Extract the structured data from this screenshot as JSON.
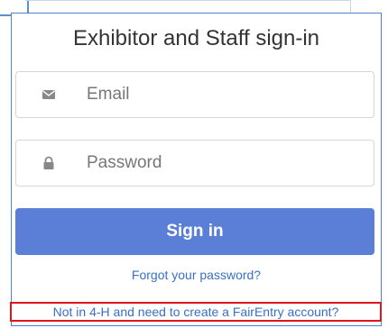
{
  "signin": {
    "title": "Exhibitor and Staff sign-in",
    "email": {
      "placeholder": "Email",
      "icon": "envelope-icon"
    },
    "password": {
      "placeholder": "Password",
      "icon": "lock-icon"
    },
    "submit_label": "Sign in",
    "forgot_link": "Forgot your password?",
    "create_account_link": "Not in 4-H and need to create a FairEntry account?"
  },
  "colors": {
    "primary_button": "#5b7fd6",
    "link": "#3a6fc4",
    "highlight_border": "#e0151b",
    "card_border": "#4a86c8"
  }
}
